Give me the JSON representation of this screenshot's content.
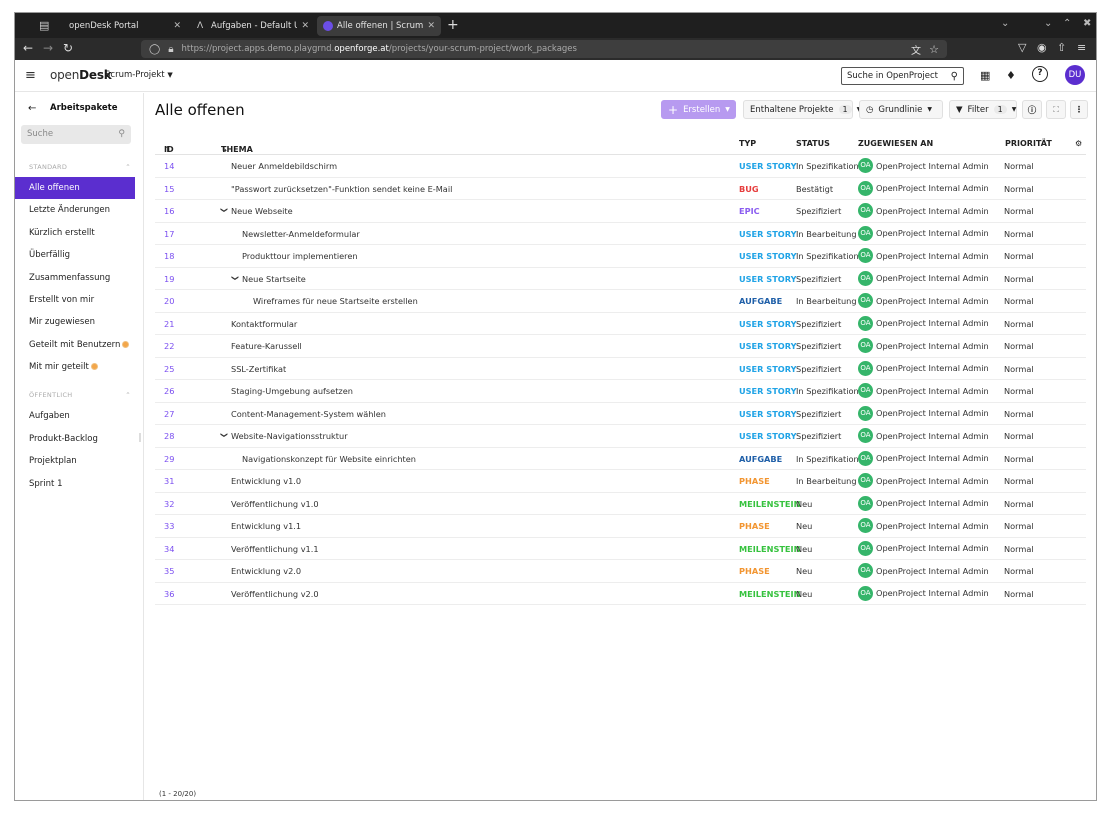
{
  "browser": {
    "tabs": [
      {
        "title": "openDesk Portal",
        "active": false
      },
      {
        "title": "Aufgaben - Default User - (",
        "active": false
      },
      {
        "title": "Alle offenen | Scrum-Proje",
        "active": true
      }
    ],
    "url_prefix": "https://project.apps.demo.playgrnd.",
    "url_host": "openforge.at",
    "url_path": "/projects/your-scrum-project/work_packages"
  },
  "header": {
    "logo_light": "open",
    "logo_bold": "Desk",
    "project": "Scrum-Projekt",
    "search_placeholder": "Suche in OpenProject",
    "user_initials": "DU",
    "help": "?"
  },
  "sidebar": {
    "title": "Arbeitspakete",
    "search_placeholder": "Suche",
    "sections": [
      {
        "label": "STANDARD",
        "items": [
          {
            "label": "Alle offenen",
            "active": true
          },
          {
            "label": "Letzte Änderungen"
          },
          {
            "label": "Kürzlich erstellt"
          },
          {
            "label": "Überfällig"
          },
          {
            "label": "Zusammenfassung"
          },
          {
            "label": "Erstellt von mir"
          },
          {
            "label": "Mir zugewiesen"
          },
          {
            "label": "Geteilt mit Benutzern",
            "badge": true
          },
          {
            "label": "Mit mir geteilt",
            "badge": true
          }
        ]
      },
      {
        "label": "ÖFFENTLICH",
        "items": [
          {
            "label": "Aufgaben"
          },
          {
            "label": "Produkt-Backlog"
          },
          {
            "label": "Projektplan"
          },
          {
            "label": "Sprint 1"
          }
        ]
      }
    ]
  },
  "main": {
    "title": "Alle offenen",
    "toolbar": {
      "create": "Erstellen",
      "included_projects": "Enthaltene Projekte",
      "included_projects_count": "1",
      "baseline": "Grundlinie",
      "filter": "Filter",
      "filter_count": "1"
    },
    "columns": {
      "id": "ID",
      "subject": "THEMA",
      "type": "TYP",
      "status": "STATUS",
      "assignee": "ZUGEWIESEN AN",
      "priority": "PRIORITÄT"
    },
    "type_colors": {
      "USER STORY": "#1fa3e6",
      "BUG": "#e63d3d",
      "EPIC": "#8a5cf0",
      "AUFGABE": "#1f5fa8",
      "PHASE": "#f29530",
      "MEILENSTEIN": "#36c23e"
    },
    "rows": [
      {
        "id": "14",
        "subject": "Neuer Anmeldebildschirm",
        "level": 0,
        "expander": false,
        "type": "USER STORY",
        "status": "In Spezifikation",
        "assignee": "OpenProject Internal Admin",
        "initials": "OA",
        "priority": "Normal"
      },
      {
        "id": "15",
        "subject": "\"Passwort zurücksetzen\"-Funktion sendet keine E-Mail",
        "level": 0,
        "expander": false,
        "type": "BUG",
        "status": "Bestätigt",
        "assignee": "OpenProject Internal Admin",
        "initials": "OA",
        "priority": "Normal"
      },
      {
        "id": "16",
        "subject": "Neue Webseite",
        "level": 0,
        "expander": true,
        "type": "EPIC",
        "status": "Spezifiziert",
        "assignee": "OpenProject Internal Admin",
        "initials": "OA",
        "priority": "Normal"
      },
      {
        "id": "17",
        "subject": "Newsletter-Anmeldeformular",
        "level": 1,
        "expander": false,
        "type": "USER STORY",
        "status": "In Bearbeitung",
        "assignee": "OpenProject Internal Admin",
        "initials": "OA",
        "priority": "Normal"
      },
      {
        "id": "18",
        "subject": "Produkttour implementieren",
        "level": 1,
        "expander": false,
        "type": "USER STORY",
        "status": "In Spezifikation",
        "assignee": "OpenProject Internal Admin",
        "initials": "OA",
        "priority": "Normal"
      },
      {
        "id": "19",
        "subject": "Neue Startseite",
        "level": 1,
        "expander": true,
        "type": "USER STORY",
        "status": "Spezifiziert",
        "assignee": "OpenProject Internal Admin",
        "initials": "OA",
        "priority": "Normal"
      },
      {
        "id": "20",
        "subject": "Wireframes für neue Startseite erstellen",
        "level": 2,
        "expander": false,
        "type": "AUFGABE",
        "status": "In Bearbeitung",
        "assignee": "OpenProject Internal Admin",
        "initials": "OA",
        "priority": "Normal"
      },
      {
        "id": "21",
        "subject": "Kontaktformular",
        "level": 0,
        "expander": false,
        "type": "USER STORY",
        "status": "Spezifiziert",
        "assignee": "OpenProject Internal Admin",
        "initials": "OA",
        "priority": "Normal"
      },
      {
        "id": "22",
        "subject": "Feature-Karussell",
        "level": 0,
        "expander": false,
        "type": "USER STORY",
        "status": "Spezifiziert",
        "assignee": "OpenProject Internal Admin",
        "initials": "OA",
        "priority": "Normal"
      },
      {
        "id": "25",
        "subject": "SSL-Zertifikat",
        "level": 0,
        "expander": false,
        "type": "USER STORY",
        "status": "Spezifiziert",
        "assignee": "OpenProject Internal Admin",
        "initials": "OA",
        "priority": "Normal"
      },
      {
        "id": "26",
        "subject": "Staging-Umgebung aufsetzen",
        "level": 0,
        "expander": false,
        "type": "USER STORY",
        "status": "In Spezifikation",
        "assignee": "OpenProject Internal Admin",
        "initials": "OA",
        "priority": "Normal"
      },
      {
        "id": "27",
        "subject": "Content-Management-System wählen",
        "level": 0,
        "expander": false,
        "type": "USER STORY",
        "status": "Spezifiziert",
        "assignee": "OpenProject Internal Admin",
        "initials": "OA",
        "priority": "Normal"
      },
      {
        "id": "28",
        "subject": "Website-Navigationsstruktur",
        "level": 0,
        "expander": true,
        "type": "USER STORY",
        "status": "Spezifiziert",
        "assignee": "OpenProject Internal Admin",
        "initials": "OA",
        "priority": "Normal"
      },
      {
        "id": "29",
        "subject": "Navigationskonzept für Website einrichten",
        "level": 1,
        "expander": false,
        "type": "AUFGABE",
        "status": "In Spezifikation",
        "assignee": "OpenProject Internal Admin",
        "initials": "OA",
        "priority": "Normal"
      },
      {
        "id": "31",
        "subject": "Entwicklung v1.0",
        "level": 0,
        "expander": false,
        "type": "PHASE",
        "status": "In Bearbeitung",
        "assignee": "OpenProject Internal Admin",
        "initials": "OA",
        "priority": "Normal"
      },
      {
        "id": "32",
        "subject": "Veröffentlichung v1.0",
        "level": 0,
        "expander": false,
        "type": "MEILENSTEIN",
        "status": "Neu",
        "assignee": "OpenProject Internal Admin",
        "initials": "OA",
        "priority": "Normal"
      },
      {
        "id": "33",
        "subject": "Entwicklung v1.1",
        "level": 0,
        "expander": false,
        "type": "PHASE",
        "status": "Neu",
        "assignee": "OpenProject Internal Admin",
        "initials": "OA",
        "priority": "Normal"
      },
      {
        "id": "34",
        "subject": "Veröffentlichung v1.1",
        "level": 0,
        "expander": false,
        "type": "MEILENSTEIN",
        "status": "Neu",
        "assignee": "OpenProject Internal Admin",
        "initials": "OA",
        "priority": "Normal"
      },
      {
        "id": "35",
        "subject": "Entwicklung v2.0",
        "level": 0,
        "expander": false,
        "type": "PHASE",
        "status": "Neu",
        "assignee": "OpenProject Internal Admin",
        "initials": "OA",
        "priority": "Normal"
      },
      {
        "id": "36",
        "subject": "Veröffentlichung v2.0",
        "level": 0,
        "expander": false,
        "type": "MEILENSTEIN",
        "status": "Neu",
        "assignee": "OpenProject Internal Admin",
        "initials": "OA",
        "priority": "Normal"
      }
    ],
    "pagination": "(1 - 20/20)"
  }
}
